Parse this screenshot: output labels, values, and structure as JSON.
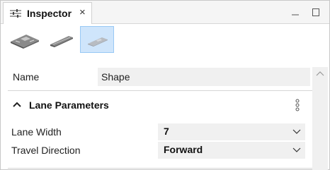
{
  "panel": {
    "tab_title": "Inspector",
    "tab_close": "×",
    "icons": [
      "sliders-icon",
      "close-icon",
      "minimize-icon",
      "maximize-icon"
    ]
  },
  "toolbar": {
    "tools": [
      {
        "icon": "road-intersection-icon",
        "selected": false
      },
      {
        "icon": "road-segment-icon",
        "selected": false
      },
      {
        "icon": "road-shape-icon",
        "selected": true
      }
    ],
    "selected_bg": "#cfe5fb"
  },
  "name_field": {
    "label": "Name",
    "value": "Shape"
  },
  "section": {
    "title": "Lane Parameters",
    "properties": [
      {
        "label": "Lane Width",
        "value": "7"
      },
      {
        "label": "Travel Direction",
        "value": "Forward"
      }
    ]
  }
}
